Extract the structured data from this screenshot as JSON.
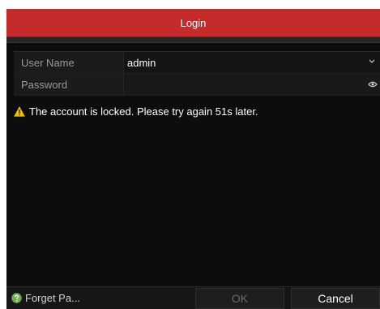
{
  "dialog": {
    "title": "Login",
    "accent_color": "#c62b2b"
  },
  "form": {
    "user_name_label": "User Name",
    "user_name_value": "admin",
    "password_label": "Password",
    "password_value": ""
  },
  "warning": {
    "icon": "warning-icon",
    "message": "The account is locked. Please try again 51s later."
  },
  "footer": {
    "forget_icon": "help-icon",
    "forget_label": "Forget Pa...",
    "ok_label": "OK",
    "cancel_label": "Cancel"
  }
}
